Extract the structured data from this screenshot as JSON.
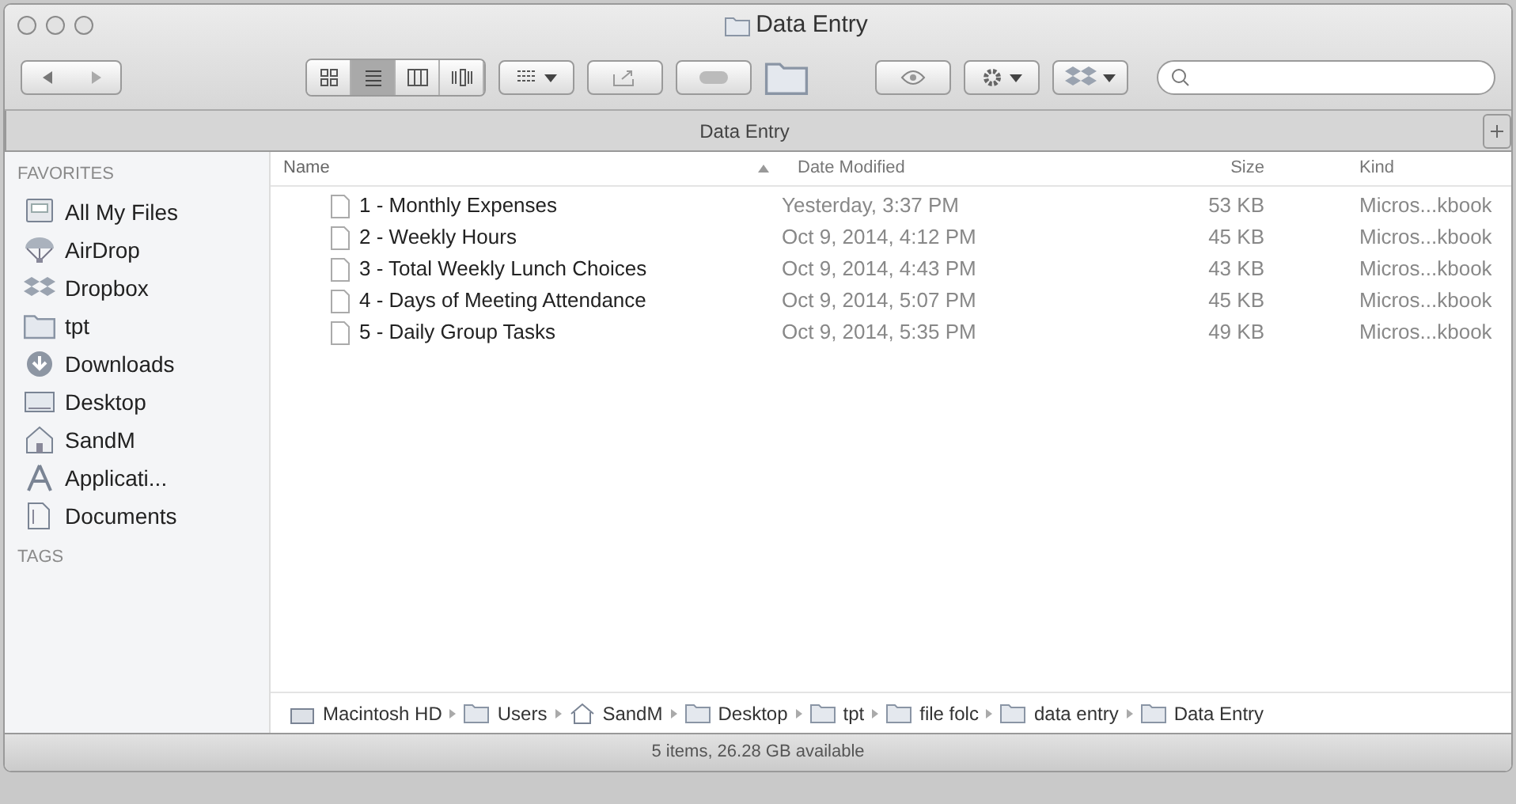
{
  "window": {
    "title": "Data Entry"
  },
  "toolbar": {
    "view_modes": [
      {
        "kind": "icons",
        "selected": false
      },
      {
        "kind": "list",
        "selected": true
      },
      {
        "kind": "columns",
        "selected": false
      },
      {
        "kind": "coverflow",
        "selected": false
      }
    ]
  },
  "tab_bar": {
    "title": "Data Entry"
  },
  "sidebar": {
    "sections": [
      {
        "title": "FAVORITES",
        "items": [
          {
            "kind": "files",
            "label": "All My Files"
          },
          {
            "kind": "airdrop",
            "label": "AirDrop"
          },
          {
            "kind": "dropbox",
            "label": "Dropbox"
          },
          {
            "kind": "folder",
            "label": "tpt"
          },
          {
            "kind": "downloads",
            "label": "Downloads"
          },
          {
            "kind": "desktop",
            "label": "Desktop"
          },
          {
            "kind": "home",
            "label": "SandM"
          },
          {
            "kind": "apps",
            "label": "Applicati..."
          },
          {
            "kind": "documents",
            "label": "Documents"
          }
        ]
      },
      {
        "title": "TAGS"
      }
    ]
  },
  "table": {
    "columns": [
      {
        "label": "Name",
        "sorted": true
      },
      {
        "label": "Date Modified",
        "sorted": false
      },
      {
        "label": "Size",
        "sorted": false
      },
      {
        "label": "Kind",
        "sorted": false
      }
    ],
    "rows": [
      [
        "1 - Monthly Expenses",
        "Yesterday, 3:37 PM",
        "53 KB",
        "Micros...kbook"
      ],
      [
        "2 - Weekly Hours",
        "Oct 9, 2014, 4:12 PM",
        "45 KB",
        "Micros...kbook"
      ],
      [
        "3 - Total Weekly Lunch Choices",
        "Oct 9, 2014, 4:43 PM",
        "43 KB",
        "Micros...kbook"
      ],
      [
        "4 - Days of Meeting Attendance",
        "Oct 9, 2014, 5:07 PM",
        "45 KB",
        "Micros...kbook"
      ],
      [
        "5 - Daily Group Tasks",
        "Oct 9, 2014, 5:35 PM",
        "49 KB",
        "Micros...kbook"
      ]
    ]
  },
  "path_bar": [
    {
      "kind": "disk",
      "label": "Macintosh HD"
    },
    {
      "kind": "folder",
      "label": "Users"
    },
    {
      "kind": "home",
      "label": "SandM"
    },
    {
      "kind": "folder",
      "label": "Desktop"
    },
    {
      "kind": "folder",
      "label": "tpt"
    },
    {
      "kind": "folder",
      "label": "file folc"
    },
    {
      "kind": "folder",
      "label": "data entry"
    },
    {
      "kind": "folder",
      "label": "Data Entry"
    }
  ],
  "status_bar": "5 items, 26.28 GB available"
}
